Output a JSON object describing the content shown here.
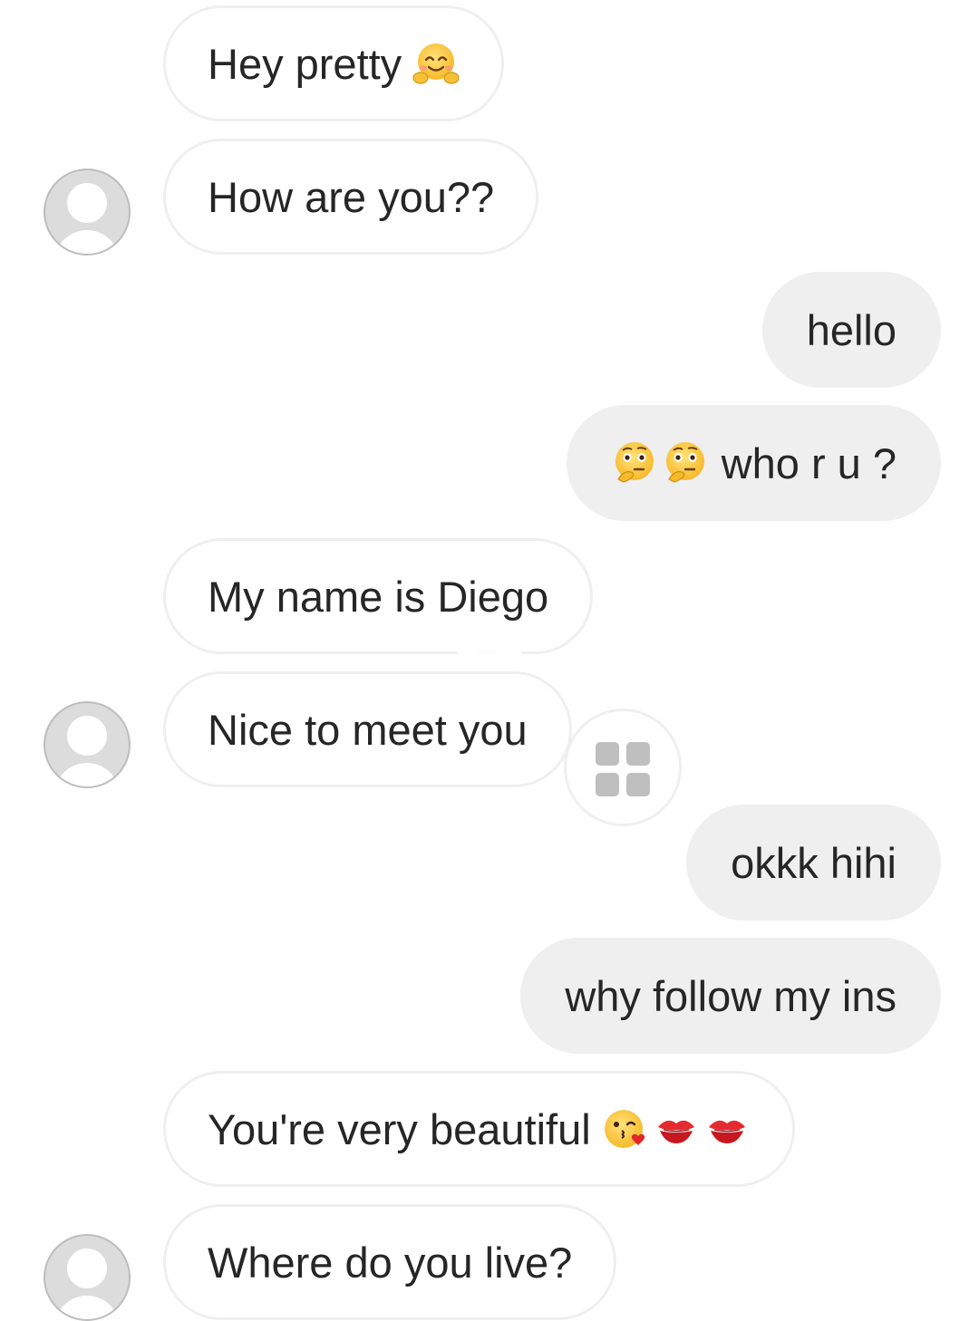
{
  "messages": [
    {
      "side": "incoming",
      "text": "Hey pretty",
      "emoji_after": [
        "hugging-face"
      ]
    },
    {
      "side": "incoming",
      "text": "How are you??"
    },
    {
      "side": "outgoing",
      "text": "hello"
    },
    {
      "side": "outgoing",
      "text": "who r u ?",
      "emoji_before": [
        "thinking-face",
        "thinking-face"
      ]
    },
    {
      "side": "incoming",
      "text": "My name is Diego"
    },
    {
      "side": "incoming",
      "text": "Nice to meet you"
    },
    {
      "side": "outgoing",
      "text": "okkk hihi"
    },
    {
      "side": "outgoing",
      "text": "why follow my ins"
    },
    {
      "side": "incoming",
      "text": "You're very beautiful",
      "emoji_after": [
        "kissing-heart-face",
        "kiss-mark",
        "kiss-mark"
      ]
    },
    {
      "side": "incoming",
      "text": "Where do you live?"
    }
  ],
  "icons": {
    "avatar": "default-user-avatar-icon",
    "react": "grid-reaction-icon"
  },
  "colors": {
    "incoming_bubble": "#ffffff",
    "incoming_border": "#efefef",
    "outgoing_bubble": "#efefef",
    "text": "#262626",
    "avatar": "#dcdcdc"
  }
}
